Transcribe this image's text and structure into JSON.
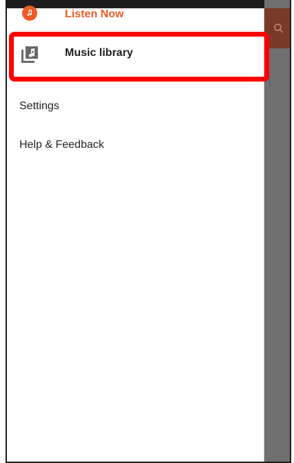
{
  "drawer": {
    "listen_now": {
      "label": "Listen Now",
      "icon": "music-note-icon",
      "color": "#ef5b22"
    },
    "music_library": {
      "label": "Music library",
      "icon": "library-music-icon"
    },
    "settings": {
      "label": "Settings"
    },
    "help_feedback": {
      "label": "Help & Feedback"
    }
  },
  "highlight_color": "#ff0000",
  "toolbar_icon": "search-icon"
}
